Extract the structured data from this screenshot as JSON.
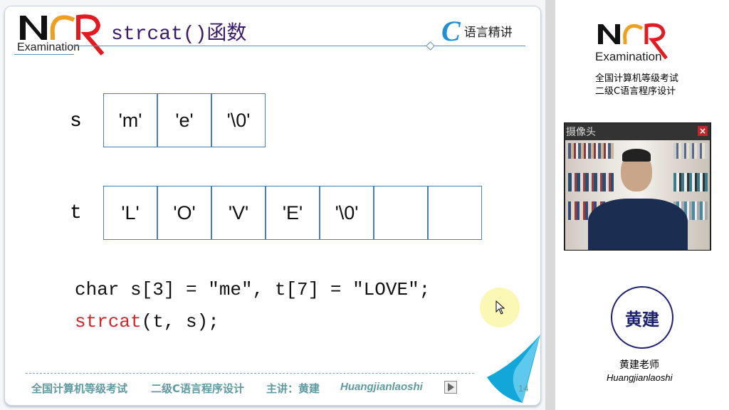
{
  "slide": {
    "logo": {
      "letters": "NCR",
      "sub": "Examination"
    },
    "title": "strcat()函数",
    "brand": {
      "c": "C",
      "text": "语言精讲"
    },
    "rows": [
      {
        "label": "s",
        "cells": [
          "'m'",
          "'e'",
          "'\\0'"
        ]
      },
      {
        "label": "t",
        "cells": [
          "'L'",
          "'O'",
          "'V'",
          "'E'",
          "'\\0'",
          "",
          ""
        ]
      }
    ],
    "code": {
      "line1": "char s[3] = ″me″, t[7] = ″LOVE″;",
      "line2_func": "strcat",
      "line2_rest": "(t, s);"
    },
    "footer": {
      "exam": "全国计算机等级考试",
      "course": "二级C语言程序设计",
      "lecturer": "主讲：黄建",
      "pinyin": "Huangjianlaoshi",
      "page": "14"
    },
    "colors": {
      "title": "#3b1a6b",
      "func": "#d0262d",
      "footer": "#5f9aa0"
    }
  },
  "panel": {
    "logo": {
      "letters": "NCR",
      "sub": "Examination"
    },
    "line1": "全国计算机等级考试",
    "line2": "二级C语言程序设计",
    "camera": {
      "title": "摄像头",
      "close": "×"
    },
    "seal": "黄建",
    "name": "黄建老师",
    "pinyin": "Huangjianlaoshi"
  }
}
